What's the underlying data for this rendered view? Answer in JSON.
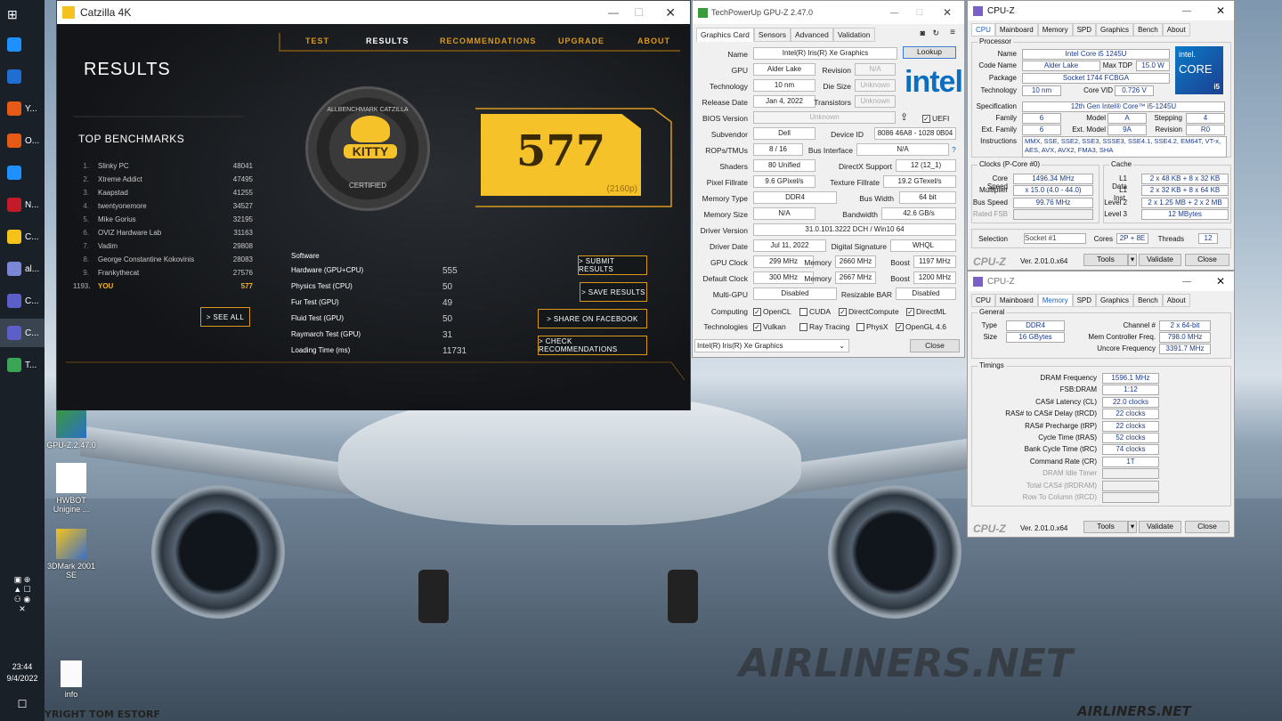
{
  "taskbar": {
    "items": [
      {
        "label": "",
        "color": "#1e90ff"
      },
      {
        "label": "",
        "color": "#1f6fd0"
      },
      {
        "label": "Y...",
        "color": "#e55b16"
      },
      {
        "label": "O...",
        "color": "#e55b16"
      },
      {
        "label": "",
        "color": "#1e90ff"
      },
      {
        "label": "N...",
        "color": "#c41b2b"
      },
      {
        "label": "C...",
        "color": "#f5c21b"
      },
      {
        "label": "al...",
        "color": "#7a86d6"
      },
      {
        "label": "C...",
        "color": "#5b5fc7"
      },
      {
        "label": "C...",
        "color": "#5b5fc7"
      },
      {
        "label": "T...",
        "color": "#3aa655"
      }
    ],
    "time": "23:44",
    "date": "9/4/2022"
  },
  "desktop": {
    "icons": [
      {
        "label": "GPU-Z.2.47.0"
      },
      {
        "label": "HWBOT Unigine ..."
      },
      {
        "label": "3DMark 2001 SE"
      },
      {
        "label": "info"
      }
    ],
    "watermark": "AIRLINERS.NET",
    "watermark2": "AIRLINERS.NET",
    "copyright": "YRIGHT TOM ESTORF"
  },
  "catzilla": {
    "title": "Catzilla 4K",
    "nav": [
      "TEST",
      "RESULTS",
      "RECOMMENDATIONS",
      "UPGRADE",
      "ABOUT"
    ],
    "heading": "RESULTS",
    "top_heading": "TOP BENCHMARKS",
    "top": [
      {
        "n": "1.",
        "name": "Slinky PC",
        "score": "48041"
      },
      {
        "n": "2.",
        "name": "Xtreme Addict",
        "score": "47495"
      },
      {
        "n": "3.",
        "name": "Kaapstad",
        "score": "41255"
      },
      {
        "n": "4.",
        "name": "twentyonemore",
        "score": "34527"
      },
      {
        "n": "5.",
        "name": "Mike Gorius",
        "score": "32195"
      },
      {
        "n": "6.",
        "name": "OVIZ Hardware Lab",
        "score": "31163"
      },
      {
        "n": "7.",
        "name": "Vadim",
        "score": "29808"
      },
      {
        "n": "8.",
        "name": "George Constantine Kokovinis",
        "score": "28083"
      },
      {
        "n": "9.",
        "name": "Frankythecat",
        "score": "27576"
      },
      {
        "n": "1193.",
        "name": "YOU",
        "score": "577"
      }
    ],
    "see_all": "> SEE ALL",
    "badge_top": "ALLBENCHMARK CATZILLA",
    "badge_name": "KITTY",
    "badge_bottom": "CERTIFIED",
    "score": "577",
    "res": "(2160p)",
    "software": "Software",
    "results": [
      {
        "label": "Hardware (GPU+CPU)",
        "value": "555"
      },
      {
        "label": "Physics Test (CPU)",
        "value": "50"
      },
      {
        "label": "Fur Test (GPU)",
        "value": "49"
      },
      {
        "label": "Fluid Test (GPU)",
        "value": "50"
      },
      {
        "label": "Raymarch Test (GPU)",
        "value": "31"
      },
      {
        "label": "Loading Time (ms)",
        "value": "11731"
      }
    ],
    "buttons": {
      "submit": "> SUBMIT RESULTS",
      "save": "> SAVE RESULTS",
      "facebook": "> SHARE ON FACEBOOK",
      "recommend": "> CHECK RECOMMENDATIONS"
    }
  },
  "gpuz": {
    "title": "TechPowerUp GPU-Z 2.47.0",
    "tabs": [
      "Graphics Card",
      "Sensors",
      "Advanced",
      "Validation"
    ],
    "lookup": "Lookup",
    "rows": {
      "name": {
        "label": "Name",
        "value": "Intel(R) Iris(R) Xe Graphics"
      },
      "gpu": {
        "label": "GPU",
        "value": "Alder Lake",
        "l2": "Revision",
        "v2": "N/A"
      },
      "tech": {
        "label": "Technology",
        "value": "10 nm",
        "l2": "Die Size",
        "v2": "Unknown"
      },
      "release": {
        "label": "Release Date",
        "value": "Jan 4, 2022",
        "l2": "Transistors",
        "v2": "Unknown"
      },
      "bios": {
        "label": "BIOS Version",
        "value": "Unknown",
        "uefi": "UEFI"
      },
      "subvendor": {
        "label": "Subvendor",
        "value": "Dell",
        "l2": "Device ID",
        "v2": "8086 46A8 - 1028 0B04"
      },
      "rops": {
        "label": "ROPs/TMUs",
        "value": "8 / 16",
        "l2": "Bus Interface",
        "v2": "N/A",
        "q": "?"
      },
      "shaders": {
        "label": "Shaders",
        "value": "80 Unified",
        "l2": "DirectX Support",
        "v2": "12 (12_1)"
      },
      "pixel": {
        "label": "Pixel Fillrate",
        "value": "9.6 GPixel/s",
        "l2": "Texture Fillrate",
        "v2": "19.2 GTexel/s"
      },
      "memtype": {
        "label": "Memory Type",
        "value": "DDR4",
        "l2": "Bus Width",
        "v2": "64 bit"
      },
      "memsize": {
        "label": "Memory Size",
        "value": "N/A",
        "l2": "Bandwidth",
        "v2": "42.6 GB/s"
      },
      "driver": {
        "label": "Driver Version",
        "value": "31.0.101.3222 DCH / Win10 64"
      },
      "driverdate": {
        "label": "Driver Date",
        "value": "Jul 11, 2022",
        "l2": "Digital Signature",
        "v2": "WHQL"
      },
      "clock": {
        "label": "GPU Clock",
        "value": "299 MHz",
        "l2": "Memory",
        "v2": "2660 MHz",
        "l3": "Boost",
        "v3": "1197 MHz"
      },
      "dclock": {
        "label": "Default Clock",
        "value": "300 MHz",
        "l2": "Memory",
        "v2": "2667 MHz",
        "l3": "Boost",
        "v3": "1200 MHz"
      },
      "multi": {
        "label": "Multi-GPU",
        "value": "Disabled",
        "l2": "Resizable BAR",
        "v2": "Disabled"
      }
    },
    "computing_label": "Computing",
    "computing": [
      "OpenCL",
      "CUDA",
      "DirectCompute",
      "DirectML"
    ],
    "tech_label": "Technologies",
    "technologies": [
      "Vulkan",
      "Ray Tracing",
      "PhysX",
      "OpenGL 4.6"
    ],
    "select": "Intel(R) Iris(R) Xe Graphics",
    "close": "Close"
  },
  "cpuz1": {
    "title": "CPU-Z",
    "tabs": [
      "CPU",
      "Mainboard",
      "Memory",
      "SPD",
      "Graphics",
      "Bench",
      "About"
    ],
    "processor": "Processor",
    "name_l": "Name",
    "name": "Intel Core i5 1245U",
    "code_l": "Code Name",
    "code": "Alder Lake",
    "tdp_l": "Max TDP",
    "tdp": "15.0 W",
    "pkg_l": "Package",
    "pkg": "Socket 1744 FCBGA",
    "tech_l": "Technology",
    "tech": "10 nm",
    "vid_l": "Core VID",
    "vid": "0.726 V",
    "spec_l": "Specification",
    "spec": "12th Gen Intel® Core™ i5-1245U",
    "fam_l": "Family",
    "fam": "6",
    "model_l": "Model",
    "model": "A",
    "step_l": "Stepping",
    "step": "4",
    "efam_l": "Ext. Family",
    "efam": "6",
    "emodel_l": "Ext. Model",
    "emodel": "9A",
    "rev_l": "Revision",
    "rev": "R0",
    "inst_l": "Instructions",
    "inst": "MMX, SSE, SSE2, SSE3, SSSE3, SSE4.1, SSE4.2, EM64T, VT-x, AES, AVX, AVX2, FMA3, SHA",
    "clocks": "Clocks (P-Core #0)",
    "cs_l": "Core Speed",
    "cs": "1496.34 MHz",
    "mult_l": "Multiplier",
    "mult": "x 15.0 (4.0 - 44.0)",
    "bus_l": "Bus Speed",
    "bus": "99.76 MHz",
    "fsb_l": "Rated FSB",
    "cache": "Cache",
    "l1d_l": "L1 Data",
    "l1d": "2 x 48 KB + 8 x 32 KB",
    "l1i_l": "L1 Inst.",
    "l1i": "2 x 32 KB + 8 x 64 KB",
    "l2_l": "Level 2",
    "l2": "2 x 1.25 MB + 2 x 2 MB",
    "l3_l": "Level 3",
    "l3": "12 MBytes",
    "sel_l": "Selection",
    "sel": "Socket #1",
    "cores_l": "Cores",
    "cores": "2P + 8E",
    "thr_l": "Threads",
    "thr": "12",
    "logo": "CPU-Z",
    "ver": "Ver. 2.01.0.x64",
    "tools": "Tools",
    "validate": "Validate",
    "close": "Close",
    "intel_brand": "intel.",
    "intel_core": "CORE",
    "intel_i": "i5"
  },
  "cpuz2": {
    "title": "CPU-Z",
    "tabs": [
      "CPU",
      "Mainboard",
      "Memory",
      "SPD",
      "Graphics",
      "Bench",
      "About"
    ],
    "general": "General",
    "type_l": "Type",
    "type": "DDR4",
    "ch_l": "Channel #",
    "ch": "2 x 64-bit",
    "size_l": "Size",
    "size": "16 GBytes",
    "mcf_l": "Mem Controller Freq.",
    "mcf": "798.0 MHz",
    "unc_l": "Uncore Frequency",
    "unc": "3391.7 MHz",
    "timings": "Timings",
    "t": [
      {
        "l": "DRAM Frequency",
        "v": "1596.1 MHz"
      },
      {
        "l": "FSB:DRAM",
        "v": "1:12"
      },
      {
        "l": "CAS# Latency (CL)",
        "v": "22.0 clocks"
      },
      {
        "l": "RAS# to CAS# Delay (tRCD)",
        "v": "22 clocks"
      },
      {
        "l": "RAS# Precharge (tRP)",
        "v": "22 clocks"
      },
      {
        "l": "Cycle Time (tRAS)",
        "v": "52 clocks"
      },
      {
        "l": "Bank Cycle Time (tRC)",
        "v": "74 clocks"
      },
      {
        "l": "Command Rate (CR)",
        "v": "1T"
      },
      {
        "l": "DRAM Idle Timer",
        "v": ""
      },
      {
        "l": "Total CAS# (tRDRAM)",
        "v": ""
      },
      {
        "l": "Row To Column (tRCD)",
        "v": ""
      }
    ],
    "logo": "CPU-Z",
    "ver": "Ver. 2.01.0.x64",
    "tools": "Tools",
    "validate": "Validate",
    "close": "Close"
  },
  "gpuz_intel": "intel"
}
